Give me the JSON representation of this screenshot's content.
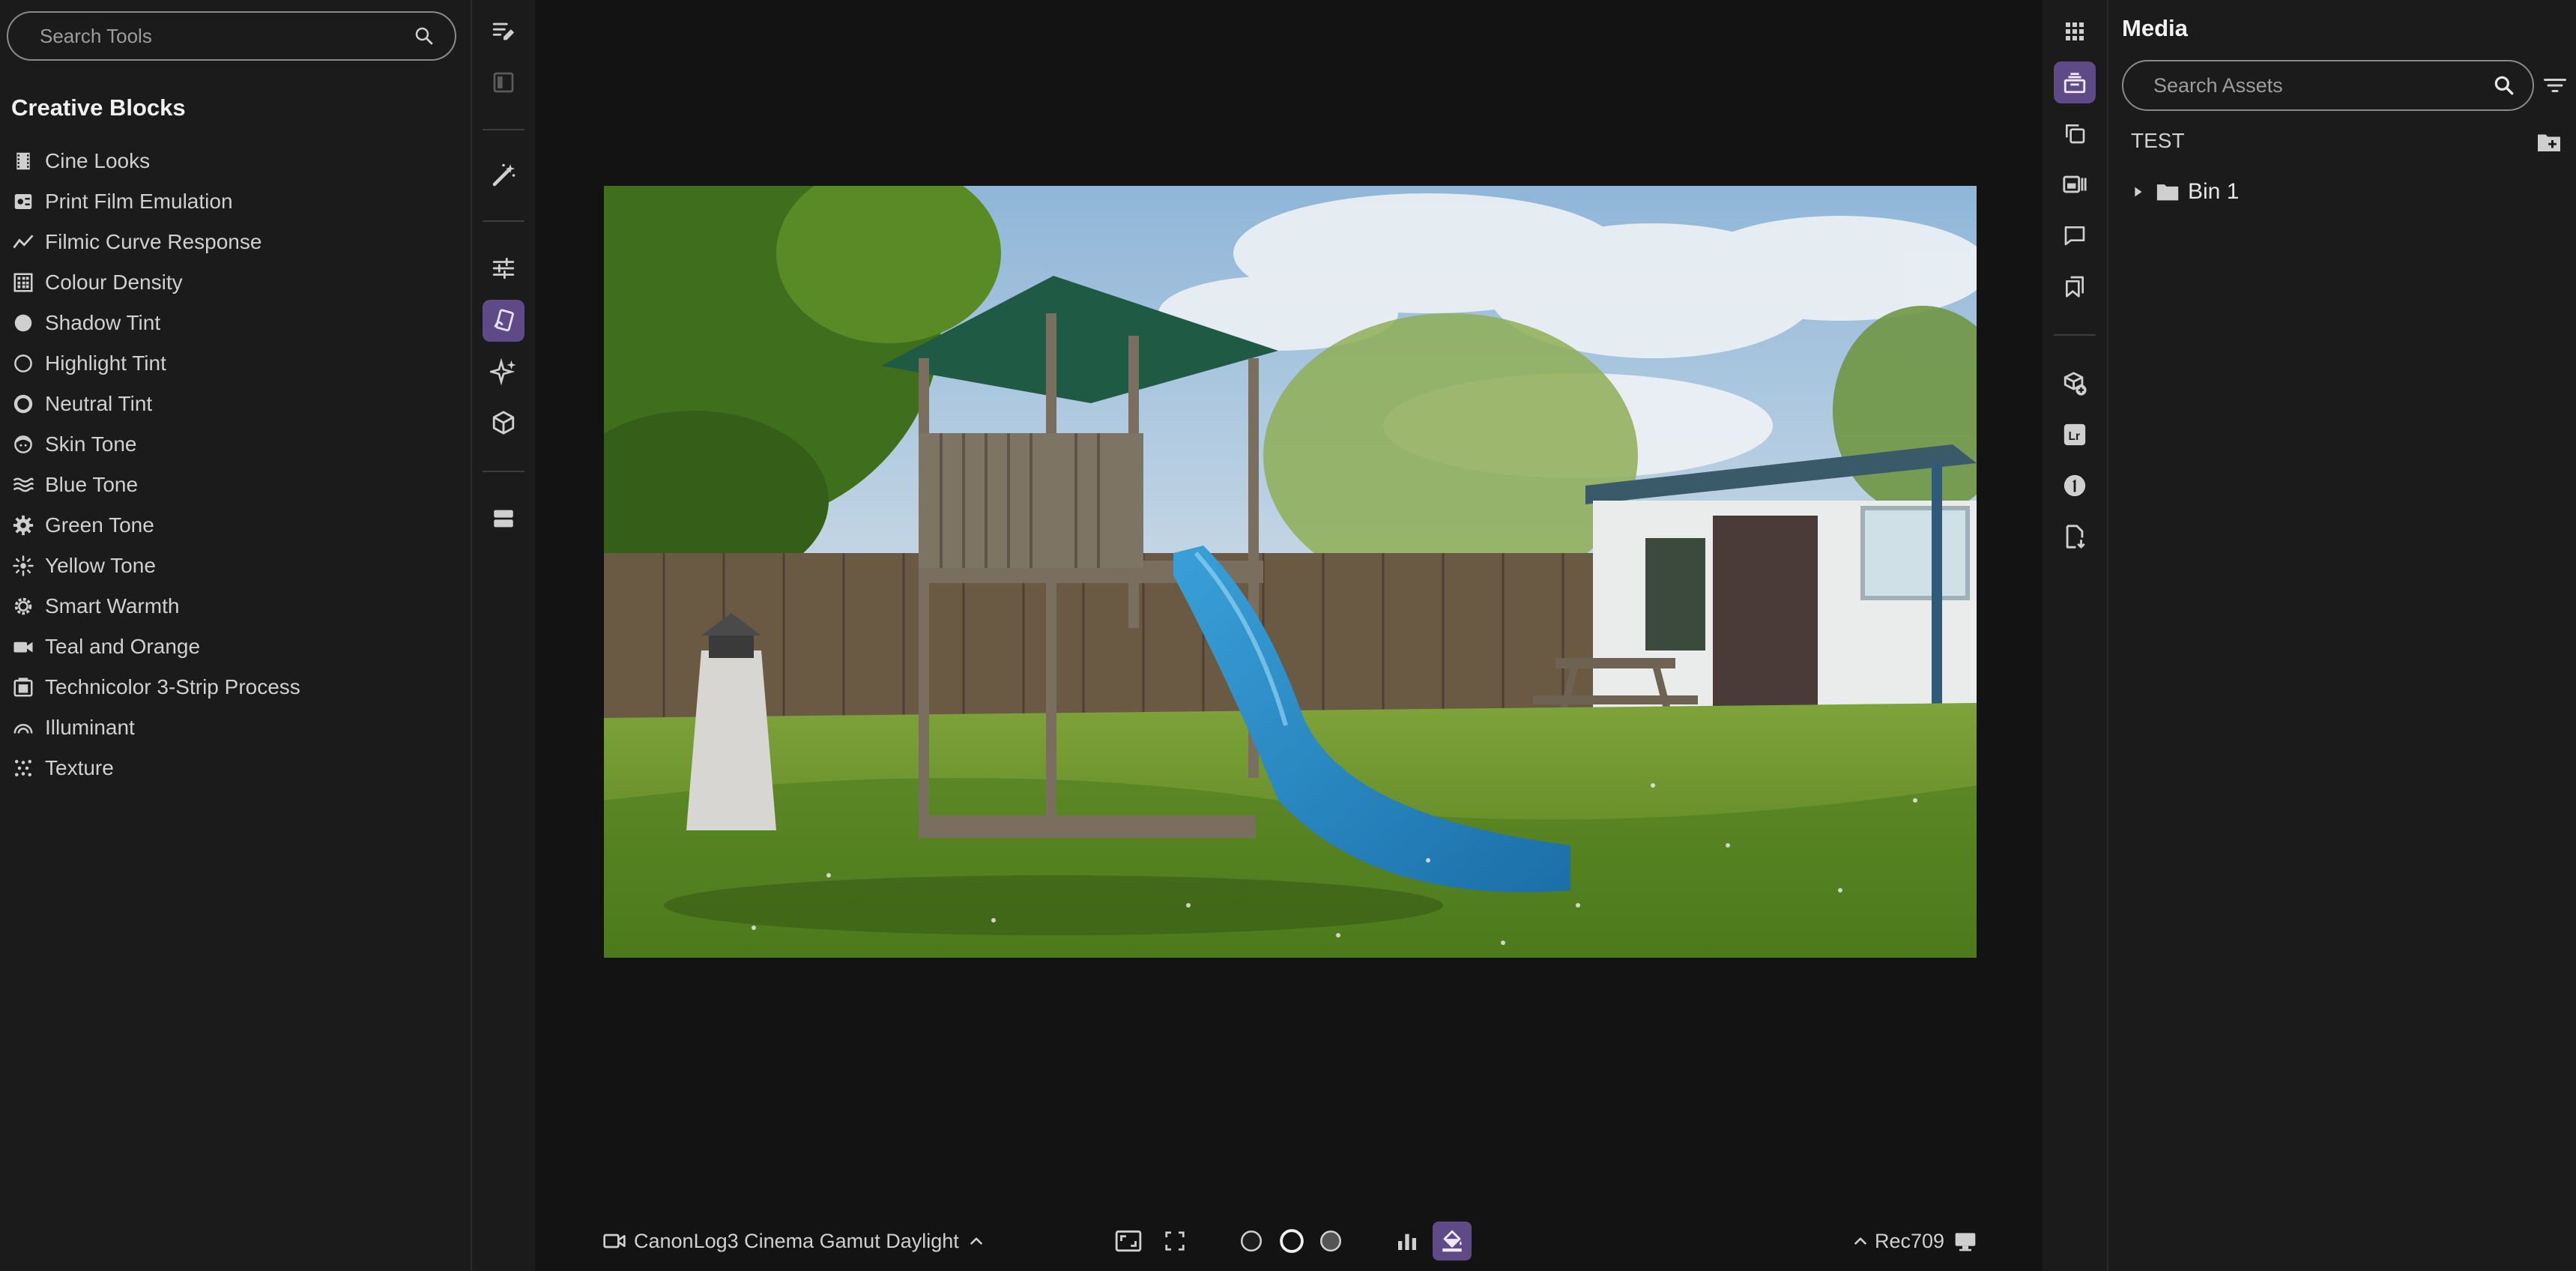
{
  "tools_panel": {
    "search_placeholder": "Search Tools",
    "section_title": "Creative Blocks",
    "items": [
      {
        "label": "Cine Looks",
        "icon": "film-strip-icon"
      },
      {
        "label": "Print Film Emulation",
        "icon": "film-roll-icon"
      },
      {
        "label": "Filmic Curve Response",
        "icon": "curve-icon"
      },
      {
        "label": "Colour Density",
        "icon": "density-grid-icon"
      },
      {
        "label": "Shadow Tint",
        "icon": "filled-circle-icon"
      },
      {
        "label": "Highlight Tint",
        "icon": "empty-circle-icon"
      },
      {
        "label": "Neutral Tint",
        "icon": "ring-circle-icon"
      },
      {
        "label": "Skin Tone",
        "icon": "face-icon"
      },
      {
        "label": "Blue Tone",
        "icon": "waves-icon"
      },
      {
        "label": "Green Tone",
        "icon": "gear-icon"
      },
      {
        "label": "Yellow Tone",
        "icon": "sun-icon"
      },
      {
        "label": "Smart Warmth",
        "icon": "warmth-gear-icon"
      },
      {
        "label": "Teal and Orange",
        "icon": "camera-icon"
      },
      {
        "label": "Technicolor 3-Strip Process",
        "icon": "strip-process-icon"
      },
      {
        "label": "Illuminant",
        "icon": "rainbow-icon"
      },
      {
        "label": "Texture",
        "icon": "texture-icon"
      }
    ]
  },
  "viewer": {
    "input_colorspace": "CanonLog3 Cinema Gamut Daylight",
    "output_colorspace": "Rec709"
  },
  "media_panel": {
    "title": "Media",
    "search_placeholder": "Search Assets",
    "project_name": "TEST",
    "bins": [
      {
        "label": "Bin 1"
      }
    ]
  },
  "colors": {
    "accent": "#5e4a86",
    "panel_bg": "#1b1b1c",
    "viewer_bg": "#131313",
    "text": "#d0d0d0"
  }
}
